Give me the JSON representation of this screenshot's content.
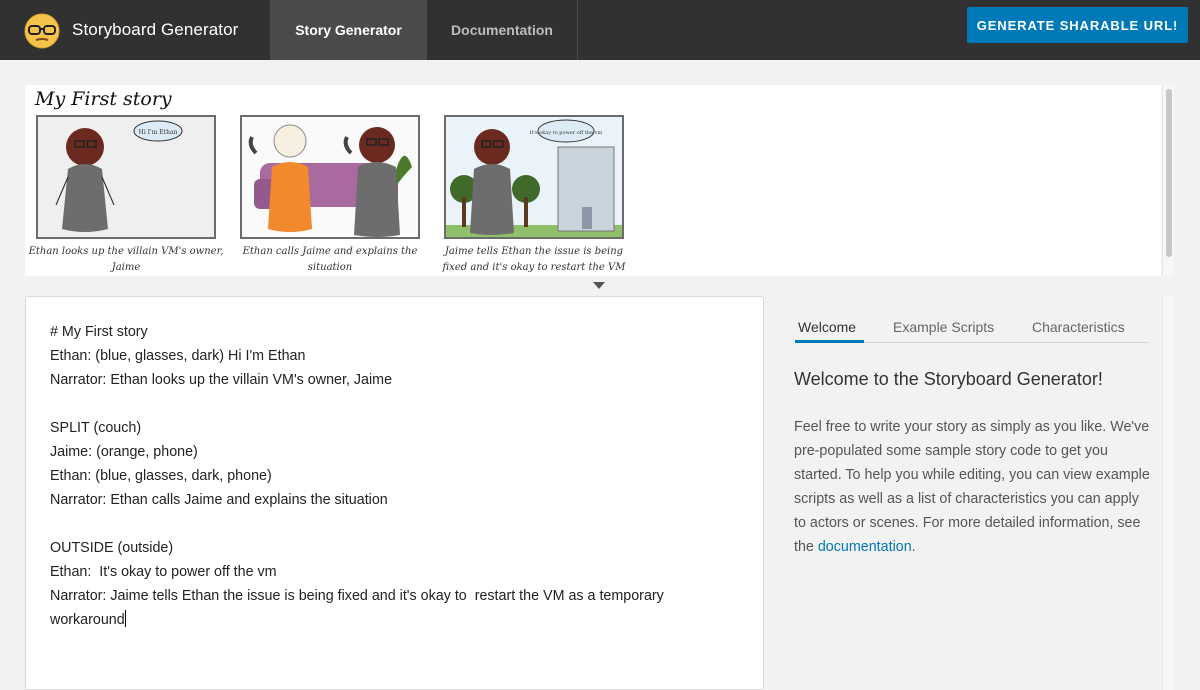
{
  "header": {
    "brand": "Storyboard Generator",
    "tabs": [
      {
        "label": "Story Generator",
        "active": true
      },
      {
        "label": "Documentation",
        "active": false
      }
    ],
    "generate_button": "GENERATE SHARABLE URL!"
  },
  "storyboard": {
    "title": "My First story",
    "panels": [
      {
        "caption": "Ethan looks up the villain VM's owner, Jaime",
        "bubble": "Hi I'm Ethan"
      },
      {
        "caption": "Ethan calls Jaime and explains the situation"
      },
      {
        "caption": "Jaime tells Ethan the issue is being fixed and it's okay to restart the VM",
        "bubble": "It's okay to power off the vm"
      }
    ]
  },
  "editor": {
    "lines": [
      "# My First story",
      "Ethan: (blue, glasses, dark) Hi I'm Ethan",
      "Narrator: Ethan looks up the villain VM's owner, Jaime",
      "",
      "SPLIT (couch)",
      "Jaime: (orange, phone)",
      "Ethan: (blue, glasses, dark, phone)",
      "Narrator: Ethan calls Jaime and explains the situation",
      "",
      "OUTSIDE (outside)",
      "Ethan:  It's okay to power off the vm",
      "Narrator: Jaime tells Ethan the issue is being fixed and it's okay to  restart the VM as a temporary",
      "workaround"
    ]
  },
  "sidebar": {
    "tabs": [
      {
        "label": "Welcome",
        "active": true
      },
      {
        "label": "Example Scripts",
        "active": false
      },
      {
        "label": "Characteristics",
        "active": false
      }
    ],
    "welcome_title": "Welcome to the Storyboard Generator!",
    "welcome_body": "Feel free to write your story as simply as you like. We've pre-populated some sample story code to get you started. To help you while editing, you can view example scripts as well as a list of characteristics you can apply to actors or scenes. For more detailed information, see the",
    "doc_link": "documentation",
    "doc_link_suffix": "."
  },
  "colors": {
    "header_bg": "#313131",
    "accent": "#0079b8"
  }
}
